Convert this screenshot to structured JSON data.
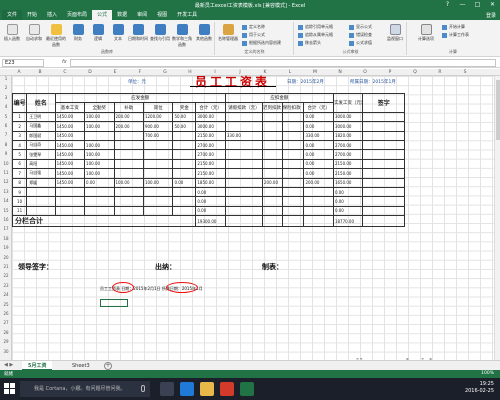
{
  "window": {
    "title": "最新员工excel工资表模板.xls [兼容模式] - Excel",
    "buttons": [
      "?",
      "—",
      "□",
      "✕"
    ]
  },
  "ribbon_tabs": [
    "文件",
    "开始",
    "插入",
    "页面布局",
    "公式",
    "数据",
    "审阅",
    "视图",
    "开发工具"
  ],
  "ribbon_tabs_active": 4,
  "ribbon_right": "登录",
  "ribbon": {
    "groups": {
      "function_library": "函数库",
      "defined_names": "定义的名称",
      "formula_auditing": "公式审核",
      "calculation": "计算"
    },
    "buttons": [
      {
        "label": "插入函数",
        "icon": "fx-icon"
      },
      {
        "label": "自动求和",
        "icon": "sigma-icon"
      },
      {
        "label": "最近使用的函数",
        "icon": "star-icon"
      },
      {
        "label": "财务",
        "icon": "book-icon"
      },
      {
        "label": "逻辑",
        "icon": "book-icon"
      },
      {
        "label": "文本",
        "icon": "book-icon"
      },
      {
        "label": "日期和时间",
        "icon": "book-icon"
      },
      {
        "label": "查找与引用",
        "icon": "book-icon"
      },
      {
        "label": "数学和三角函数",
        "icon": "book-icon"
      },
      {
        "label": "其他函数",
        "icon": "book-icon"
      },
      {
        "label": "名称管理器",
        "icon": "tag-icon"
      },
      {
        "label": "监视窗口",
        "icon": "watch-icon"
      },
      {
        "label": "计算选项",
        "icon": "calc-icon"
      }
    ],
    "name_items": [
      "定义名称",
      "用于公式",
      "根据所选内容创建"
    ],
    "audit_items": [
      "追踪引用单元格",
      "追踪从属单元格",
      "移去箭头",
      "显示公式",
      "错误检查",
      "公式求值"
    ],
    "calc_items": [
      "开始计算",
      "计算工作表"
    ]
  },
  "formula_bar": {
    "name_box": "E23",
    "fx": "fx",
    "value": ""
  },
  "columns": [
    "A",
    "B",
    "C",
    "D",
    "E",
    "F",
    "G",
    "H",
    "I",
    "J",
    "K",
    "L",
    "M",
    "N",
    "O",
    "P",
    "Q",
    "R",
    "S"
  ],
  "rows": [
    "1",
    "2",
    "3",
    "4",
    "5",
    "6",
    "7",
    "8",
    "9",
    "10",
    "11",
    "12",
    "13",
    "14",
    "15",
    "16",
    "17",
    "18",
    "19",
    "20",
    "21",
    "22",
    "23",
    "24",
    "25",
    "26",
    "27",
    "28",
    "29",
    "30"
  ],
  "sheet": {
    "title": "员工工资表",
    "unit": "单位：元",
    "date_label": "日期：2015年2月",
    "period": "所属日期：2015年1月",
    "headers": {
      "num": "编号",
      "name": "姓名",
      "payable": "应发金额",
      "deduct": "应扣金额",
      "net": "实发工资（元）",
      "sign": "签字",
      "cols": [
        "基本工资",
        "全勤奖",
        "补助",
        "岗位",
        "奖金",
        "合计（元）",
        "请假扣款（元）",
        "迟到扣款（元）",
        "保险扣款（元）",
        "合计（元）"
      ]
    },
    "rows": [
      {
        "no": "1",
        "name": "王卫明",
        "vals": [
          "1450.00",
          "100.00",
          "200.00",
          "1200.00",
          "50.00",
          "3000.00",
          "",
          "",
          "",
          "0.00",
          "3000.00"
        ]
      },
      {
        "no": "2",
        "name": "马国鑫",
        "vals": [
          "1450.00",
          "100.00",
          "200.00",
          "900.00",
          "50.00",
          "3000.00",
          "",
          "",
          "",
          "0.00",
          "3000.00"
        ]
      },
      {
        "no": "3",
        "name": "郎国斌",
        "vals": [
          "1450.00",
          "",
          "",
          "700.00",
          "",
          "2150.00",
          "330.00",
          "",
          "",
          "330.00",
          "1820.00"
        ]
      },
      {
        "no": "4",
        "name": "马自奇",
        "vals": [
          "1450.00",
          "100.00",
          "",
          "",
          "",
          "2700.00",
          "",
          "",
          "",
          "0.00",
          "2700.00"
        ]
      },
      {
        "no": "5",
        "name": "张雯琴",
        "vals": [
          "1450.00",
          "100.00",
          "",
          "",
          "",
          "2700.00",
          "",
          "",
          "",
          "0.00",
          "2700.00"
        ]
      },
      {
        "no": "6",
        "name": "高阳",
        "vals": [
          "1450.00",
          "100.00",
          "",
          "",
          "",
          "2150.00",
          "",
          "",
          "",
          "0.00",
          "2150.00"
        ]
      },
      {
        "no": "7",
        "name": "马自强",
        "vals": [
          "1450.00",
          "100.00",
          "",
          "",
          "",
          "2150.00",
          "",
          "",
          "",
          "0.00",
          "2150.00"
        ]
      },
      {
        "no": "8",
        "name": "郑媛",
        "vals": [
          "1450.00",
          "0.00",
          "100.00",
          "100.00",
          "0.00",
          "1850.00",
          "",
          "200.00",
          "",
          "200.00",
          "1650.00"
        ]
      },
      {
        "no": "9",
        "name": "",
        "vals": [
          "",
          "",
          "",
          "",
          "",
          "0.00",
          "",
          "",
          "",
          "",
          "0.00"
        ]
      },
      {
        "no": "10",
        "name": "",
        "vals": [
          "",
          "",
          "",
          "",
          "",
          "0.00",
          "",
          "",
          "",
          "",
          "0.00"
        ]
      },
      {
        "no": "11",
        "name": "",
        "vals": [
          "",
          "",
          "",
          "",
          "",
          "0.00",
          "",
          "",
          "",
          "",
          "0.00"
        ]
      }
    ],
    "total_label": "分栏合计",
    "total_sum": "19300.00",
    "total_net": "18770.00",
    "signatures": [
      "领导签字：",
      "出纳：",
      "制表："
    ],
    "note_parts": [
      "员工工",
      "资表",
      "   日",
      "期",
      "：2015年2月",
      "1日",
      "   所属",
      "日期",
      "：2015年1月"
    ]
  },
  "sheet_tabs": [
    "5月工资",
    "Sheet3"
  ],
  "sheet_tabs_active": 0,
  "status": {
    "left": "就绪",
    "zoom": "100%"
  },
  "taskbar": {
    "search": "我是 Cortana，小娜。有问题尽管问我。",
    "time": "19:25",
    "date": "2016-02-25"
  },
  "watermark": "jingyan.baidu.com",
  "colors": {
    "excel_green": "#217346",
    "title_red": "#cc0000",
    "annotation_red": "#ee1111"
  }
}
